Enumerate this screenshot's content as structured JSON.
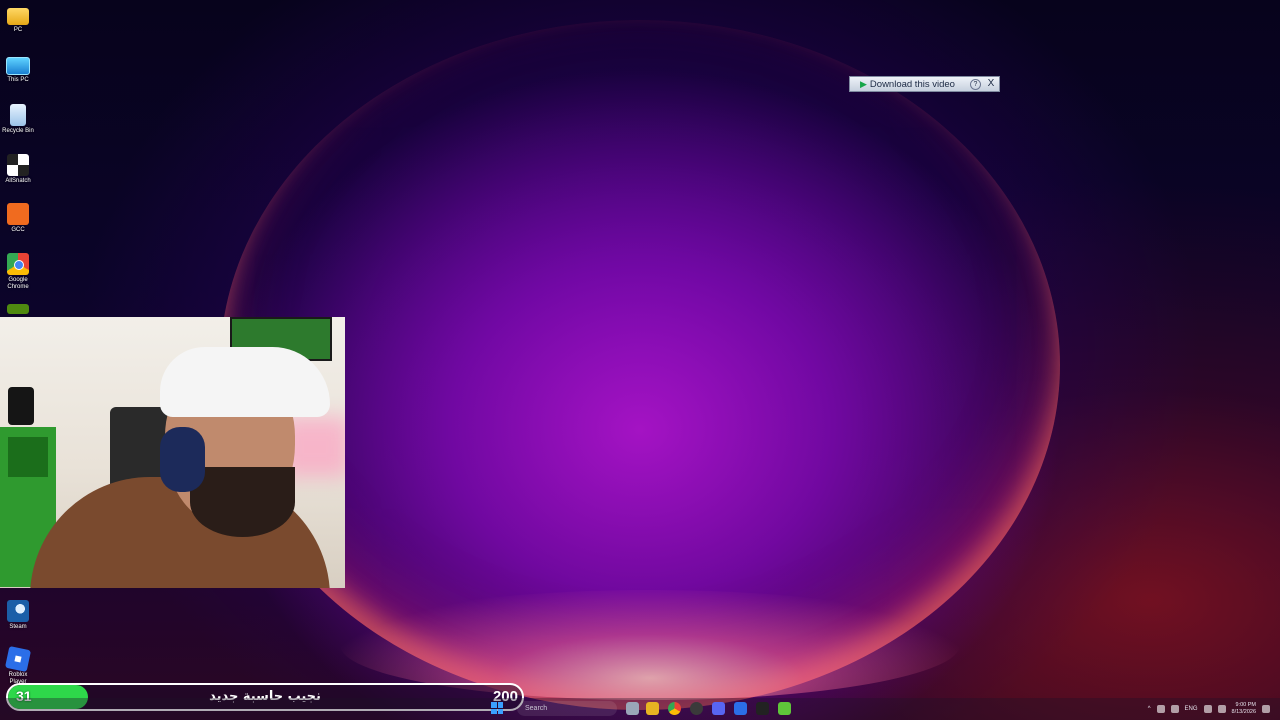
{
  "desktop": {
    "icons": [
      {
        "label": "PC",
        "icon": "folder-icon"
      },
      {
        "label": "This PC",
        "icon": "monitor-icon"
      },
      {
        "label": "Recycle Bin",
        "icon": "recycle-bin-icon"
      },
      {
        "label": "AllSnatch",
        "icon": "allsnatch-icon"
      },
      {
        "label": "GCC",
        "icon": "gcc-icon"
      },
      {
        "label": "Google Chrome",
        "icon": "chrome-icon"
      },
      {
        "label": "",
        "icon": "nvidia-icon"
      },
      {
        "label": "Steam",
        "icon": "steam-icon"
      },
      {
        "label": "Roblox Player",
        "icon": "roblox-icon"
      }
    ]
  },
  "download_bar": {
    "label": "Download this video",
    "help": "?",
    "close": "X"
  },
  "progress": {
    "current": "31",
    "title": "نجيب حاسبة جديد",
    "goal": "200",
    "fraction": 0.155,
    "fill_color": "#2ed84a"
  },
  "taskbar": {
    "search_placeholder": "Search",
    "tray_language": "ENG",
    "clock_time": "9:00 PM",
    "clock_date": "8/13/2026"
  }
}
